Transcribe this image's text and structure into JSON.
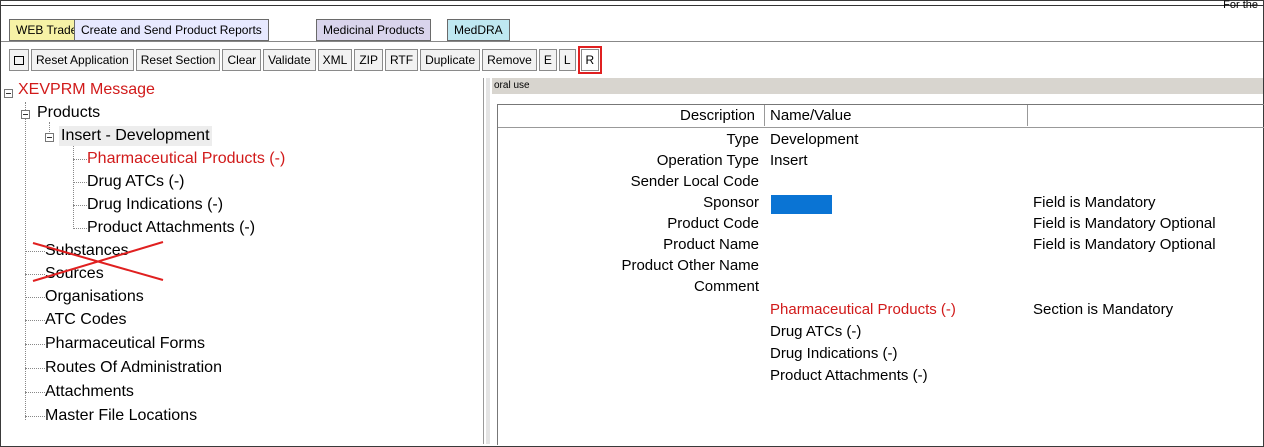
{
  "window": {
    "corner_text": "For the"
  },
  "tabs": [
    {
      "label": "WEB Trader"
    },
    {
      "label": "Create and Send Product Reports"
    },
    {
      "label": "Medicinal Products"
    },
    {
      "label": "MedDRA"
    }
  ],
  "toolbar": {
    "buttons": [
      "Reset Application",
      "Reset Section",
      "Clear",
      "Validate",
      "XML",
      "ZIP",
      "RTF",
      "Duplicate",
      "Remove",
      "E",
      "L",
      "R"
    ],
    "selected": "R"
  },
  "tree": {
    "root": "XEVPRM Message",
    "products": "Products",
    "insert": "Insert - Development",
    "children": [
      "Pharmaceutical Products (-)",
      "Drug ATCs (-)",
      "Drug Indications (-)",
      "Product Attachments (-)"
    ],
    "top_items": [
      "Substances",
      "Sources",
      "Organisations",
      "ATC Codes",
      "Pharmaceutical Forms",
      "Routes Of Administration",
      "Attachments",
      "Master File Locations"
    ]
  },
  "detail": {
    "path": "oral use",
    "headers": {
      "description": "Description",
      "value": "Name/Value"
    },
    "rows": [
      {
        "desc": "Type",
        "value": "Development",
        "note": ""
      },
      {
        "desc": "Operation Type",
        "value": "Insert",
        "note": ""
      },
      {
        "desc": "Sender Local Code",
        "value": "",
        "note": ""
      },
      {
        "desc": "Sponsor",
        "value": "",
        "note": "Field is Mandatory"
      },
      {
        "desc": "Product Code",
        "value": "",
        "note": "Field is Mandatory Optional"
      },
      {
        "desc": "Product Name",
        "value": "",
        "note": "Field is Mandatory Optional"
      },
      {
        "desc": "Product Other Name",
        "value": "",
        "note": ""
      },
      {
        "desc": "Comment",
        "value": "",
        "note": ""
      }
    ],
    "links": [
      "Pharmaceutical Products (-)",
      "Drug ATCs (-)",
      "Drug Indications (-)",
      "Product Attachments (-)"
    ],
    "section_note": "Section is Mandatory"
  },
  "colors": {
    "accent_red": "#d11a1a",
    "sponsor_blue": "#0a74d4"
  }
}
